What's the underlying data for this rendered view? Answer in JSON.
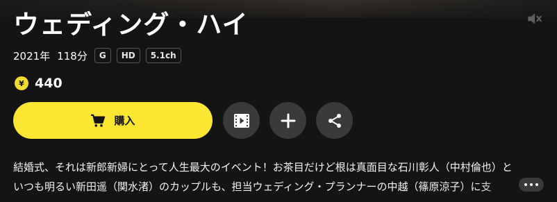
{
  "title": "ウェディング・ハイ",
  "meta": {
    "year": "2021年",
    "duration": "118分",
    "badges": [
      "G",
      "HD",
      "5.1ch"
    ]
  },
  "price": {
    "coin_symbol": "¥",
    "value": "440"
  },
  "actions": {
    "buy_label": "購入",
    "buy_icon": "cart-icon",
    "trailer_icon": "film-icon",
    "add_icon": "plus-icon",
    "share_icon": "share-icon",
    "mute_icon": "speaker-muted-icon"
  },
  "description": {
    "line1": "結婚式、それは新郎新婦にとって人生最大のイベント！お茶目だけど根は真面目な石川彰人（中村倫也）と",
    "line2": "いつも明るい新田遥（関水渚）のカップルも、担当ウェディング・プランナーの中越（篠原涼子）に支"
  },
  "colors": {
    "background": "#141414",
    "accent_yellow": "#fbe631",
    "coin_yellow": "#f5dc2c",
    "circle_button": "#3a3a3a"
  }
}
